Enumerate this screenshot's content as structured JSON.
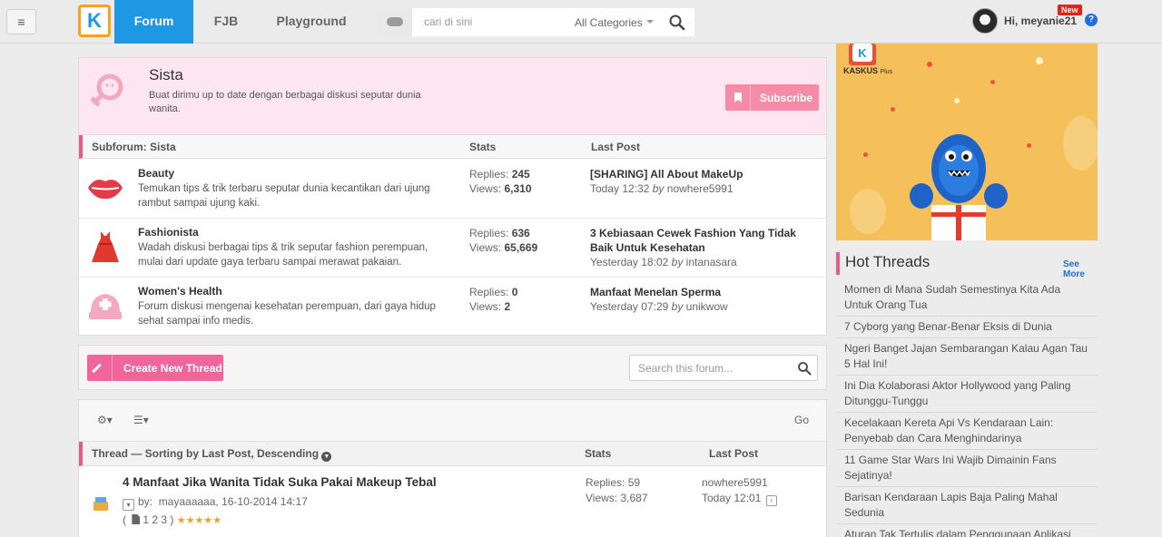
{
  "nav": {
    "tabs": [
      {
        "label": "Forum",
        "active": true
      },
      {
        "label": "FJB",
        "active": false
      },
      {
        "label": "Playground",
        "active": false
      }
    ],
    "search_placeholder": "cari di sini",
    "category": "All Categories",
    "greeting": "Hi, meyanie21",
    "new_badge": "New",
    "help": "?"
  },
  "forum": {
    "title": "Sista",
    "description": "Buat dirimu up to date dengan berbagai diskusi seputar dunia wanita.",
    "subscribe_label": "Subscribe"
  },
  "subforum": {
    "headers": {
      "name": "Subforum: Sista",
      "stats": "Stats",
      "last_post": "Last Post"
    },
    "rows": [
      {
        "name": "Beauty",
        "description": "Temukan tips & trik terbaru seputar dunia kecantikan dari ujung rambut sampai ujung kaki.",
        "replies_label": "Replies:",
        "replies": "245",
        "views_label": "Views:",
        "views": "6,310",
        "last_title": "[SHARING] All About MakeUp",
        "last_time": "Today 12:32",
        "by": "by",
        "last_user": "nowhere5991",
        "icon": "lips-icon"
      },
      {
        "name": "Fashionista",
        "description": "Wadah diskusi berbagai tips & trik seputar fashion perempuan, mulai dari update gaya terbaru sampai merawat pakaian.",
        "replies_label": "Replies:",
        "replies": "636",
        "views_label": "Views:",
        "views": "65,669",
        "last_title": "3 Kebiasaan Cewek Fashion Yang Tidak Baik Untuk Kesehatan",
        "last_time": "Yesterday 18:02",
        "by": "by",
        "last_user": "intanasara",
        "icon": "dress-icon"
      },
      {
        "name": "Women's Health",
        "description": "Forum diskusi mengenai kesehatan perempuan, dari gaya hidup sehat sampai info medis.",
        "replies_label": "Replies:",
        "replies": "0",
        "views_label": "Views:",
        "views": "2",
        "last_title": "Manfaat Menelan Sperma",
        "last_time": "Yesterday 07:29",
        "by": "by",
        "last_user": "unikwow",
        "icon": "nurse-cap-icon"
      }
    ]
  },
  "actions": {
    "create_label": "Create New Thread",
    "search_placeholder": "Search this forum..."
  },
  "thread_list": {
    "go": "Go",
    "header_sort": "Thread — Sorting by Last Post, Descending",
    "header_stats": "Stats",
    "header_last": "Last Post",
    "threads": [
      {
        "title": "4 Manfaat Jika Wanita Tidak Suka Pakai Makeup Tebal",
        "by_label": "by:",
        "author_date": "mayaaaaaa, 16-10-2014 14:17",
        "pages": "1   2   3",
        "rating": "★★★★★",
        "replies": "Replies: 59",
        "views": "Views: 3,687",
        "last_user": "nowhere5991",
        "last_time": "Today 12:01"
      }
    ]
  },
  "sidebar": {
    "ad_brand": "KASKUS",
    "ad_brand_suffix": "Plus",
    "hot_title": "Hot Threads",
    "see_more": "See More",
    "hot_threads": [
      "Momen di Mana Sudah Semestinya Kita Ada Untuk Orang Tua",
      "7 Cyborg yang Benar-Benar Eksis di Dunia",
      "Ngeri Banget Jajan Sembarangan Kalau Agan Tau 5 Hal Ini!",
      "Ini Dia Kolaborasi Aktor Hollywood yang Paling Ditunggu-Tunggu",
      "Kecelakaan Kereta Api Vs Kendaraan Lain: Penyebab dan Cara Menghindarinya",
      "11 Game Star Wars Ini Wajib Dimainin Fans Sejatinya!",
      "Barisan Kendaraan Lapis Baja Paling Mahal Sedunia",
      "Aturan Tak Tertulis dalam Penggunaan Aplikasi Chatting yang Harus Agan Tau"
    ]
  },
  "colors": {
    "brand_blue": "#1e98e3",
    "accent_pink": "#e85a8c",
    "create_pink": "#f0659a",
    "subscribe_pink": "#f58ba9",
    "forum_bg": "#fde6ef"
  }
}
